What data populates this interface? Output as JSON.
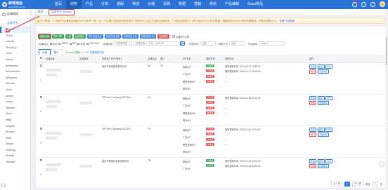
{
  "app": {
    "logo_title": "跨境速运",
    "logo_sub": "KUAJINGSUYUN"
  },
  "nav": [
    "首页",
    "授权",
    "产品",
    "订单",
    "客服",
    "物流",
    "仓储",
    "采购",
    "数据",
    "营销",
    "财务",
    "产品编辑",
    "Ozon商品"
  ],
  "nav_active_index": 1,
  "sidebar": {
    "header": "店铺授权",
    "sub": "全部平台",
    "items": [
      "Shopee",
      "TikTok",
      "Lazada",
      "Temu本土",
      "Ozon",
      "Vaolux",
      "Wildberries",
      "Mercadolibre",
      "AliExpress",
      "AliLocal",
      "Joom",
      "Allegro",
      "Jumia",
      "Walmart",
      "Shein",
      "eBay",
      "Gmgala",
      "Amazon",
      "Wish",
      "Allegro",
      "NewEgg",
      "Shopify",
      "Takealot"
    ],
    "active_index": 0
  },
  "tabs": {
    "home": "首页",
    "current": "全部平台 Shopee"
  },
  "notice": {
    "text": "关于授权：1. 授权时店铺登录需要与ERP账号一致；如一个店铺已经授权到系统其它子账号可以后往已授权店铺查询；2. 授权后需要过一段时间后才可以同步数据；需要绑定Shopee授权所需要手，请到到授权中心，",
    "link": "查看介绍视频"
  },
  "toolbar": {
    "buttons": [
      {
        "label": "授权店铺",
        "color": "green",
        "current": true
      },
      {
        "label": "同步订单",
        "color": "green"
      },
      {
        "label": "入驻",
        "color": "green"
      },
      {
        "label": "批量授权",
        "color": "green"
      },
      {
        "label": "同步商品信息",
        "color": "blue"
      },
      {
        "label": "批量修改店铺",
        "color": "blue"
      },
      {
        "label": "批量绑定仓库",
        "color": "blue"
      },
      {
        "label": "批量修改分组",
        "color": "blue"
      },
      {
        "label": "批量删除",
        "color": "red"
      }
    ],
    "hint": "店铺操作说明"
  },
  "filters": {
    "site_label": "店铺站点",
    "sites": [
      "全站",
      "CNSC",
      "SIP",
      "本地",
      "1P/2P/3P"
    ],
    "group_label": "店铺分组",
    "group_placeholder": "请选择分组",
    "search_type": "店铺名称",
    "search_placeholder": "请输入店铺名称",
    "status_label": "授权状态",
    "status_value": "全部",
    "sort_label": "排序方式",
    "sort_value": "全部",
    "platform_label": "平台选择",
    "platform_value": "Shopee"
  },
  "subtabs": {
    "items": [
      "店铺",
      "账户"
    ],
    "active_index": 0,
    "stats_prefix": "Shopee店铺数: 4 / 999",
    "stats_link": "查看授权状态"
  },
  "table": {
    "headers": [
      "",
      "店铺名称",
      "店铺账号",
      "所属账户(ERP账号)",
      "店铺站点",
      "备注",
      "API名称",
      "授权状态",
      "授权时间",
      "操作"
    ],
    "rows": [
      {
        "seq": "1",
        "account": "南京市某某服务有限公司",
        "site": "MY",
        "remark": "TK",
        "apis": [
          {
            "name": "基础API",
            "status": "已授权",
            "ok": true,
            "time": "授权更新时间: 2025-06-24 15:52:19"
          },
          {
            "name": "广告API",
            "status": "已过期",
            "ok": false,
            "time": "授权更新时间: 2025-04-17 16:36:09"
          },
          {
            "name": "联盟营销API",
            "status": "未授权",
            "ok": false,
            "time": "—"
          },
          {
            "name": "物流API",
            "status": "未授权",
            "ok": false,
            "time": "—"
          }
        ]
      },
      {
        "seq": "2",
        "account": "ERP test Company23121501",
        "site": "MY",
        "remark": "",
        "apis": [
          {
            "name": "基础API",
            "status": "已过期",
            "ok": false,
            "time": "授权更新时间: 2025-01-04 21:00:00"
          },
          {
            "name": "广告API",
            "status": "未授权",
            "ok": false,
            "time": "—"
          },
          {
            "name": "联盟营销API",
            "status": "未授权",
            "ok": false,
            "time": "—"
          },
          {
            "name": "物流API",
            "status": "未授权",
            "ok": false,
            "time": "—"
          }
        ]
      },
      {
        "seq": "3",
        "account": "ERP test Company23121501",
        "site": "TH",
        "remark": "",
        "apis": [
          {
            "name": "基础API",
            "status": "已过期",
            "ok": false,
            "time": "授权更新时间: 2025-01-04 21:00:00"
          },
          {
            "name": "广告API",
            "status": "未授权",
            "ok": false,
            "time": "—"
          },
          {
            "name": "联盟营销API",
            "status": "未授权",
            "ok": false,
            "time": "—"
          },
          {
            "name": "物流API",
            "status": "未授权",
            "ok": false,
            "time": "—"
          }
        ]
      },
      {
        "seq": "4",
        "account": "福州市鼓楼区某某电商科技",
        "site": "TW",
        "remark": "",
        "apis": [
          {
            "name": "基础API",
            "status": "已授权",
            "ok": true,
            "time": "授权更新时间: 2025-10-15 20:00:00"
          },
          {
            "name": "广告API",
            "status": "已授权",
            "ok": true,
            "time": "授权更新时间: 2025-10-15 20:00:00"
          }
        ]
      }
    ],
    "ops": [
      "修改",
      "绑仓",
      "同步",
      "删除",
      "店铺授权"
    ]
  },
  "pager": {
    "prev": "上一页",
    "pages": [
      "1"
    ],
    "next": "下一页",
    "goto_label": "前往",
    "goto_value": "1",
    "unit": "页"
  }
}
